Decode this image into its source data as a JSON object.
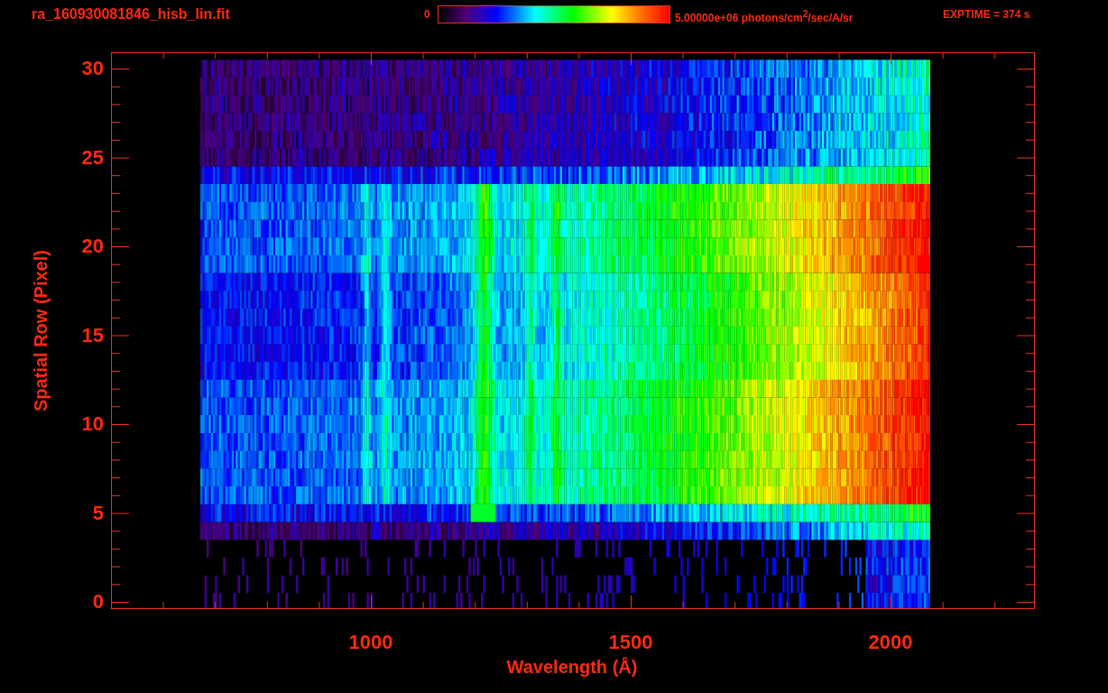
{
  "header": {
    "title": "ra_160930081846_hisb_lin.fit",
    "colorbar": {
      "min_label": "0",
      "max_label": "5.00000e+06 photons/cm$^{2}$/sec/A/sr"
    },
    "exposure": "EXPTIME = 374 s"
  },
  "plot": {
    "y_axis": {
      "label": "Spatial Row (Pixel)",
      "ticks": [
        "30",
        "25",
        "20",
        "15",
        "10",
        "5",
        "0"
      ]
    },
    "x_axis": {
      "label": "Wavelength (Å)",
      "ticks": [
        "1000",
        "1500",
        "2000"
      ]
    }
  }
}
